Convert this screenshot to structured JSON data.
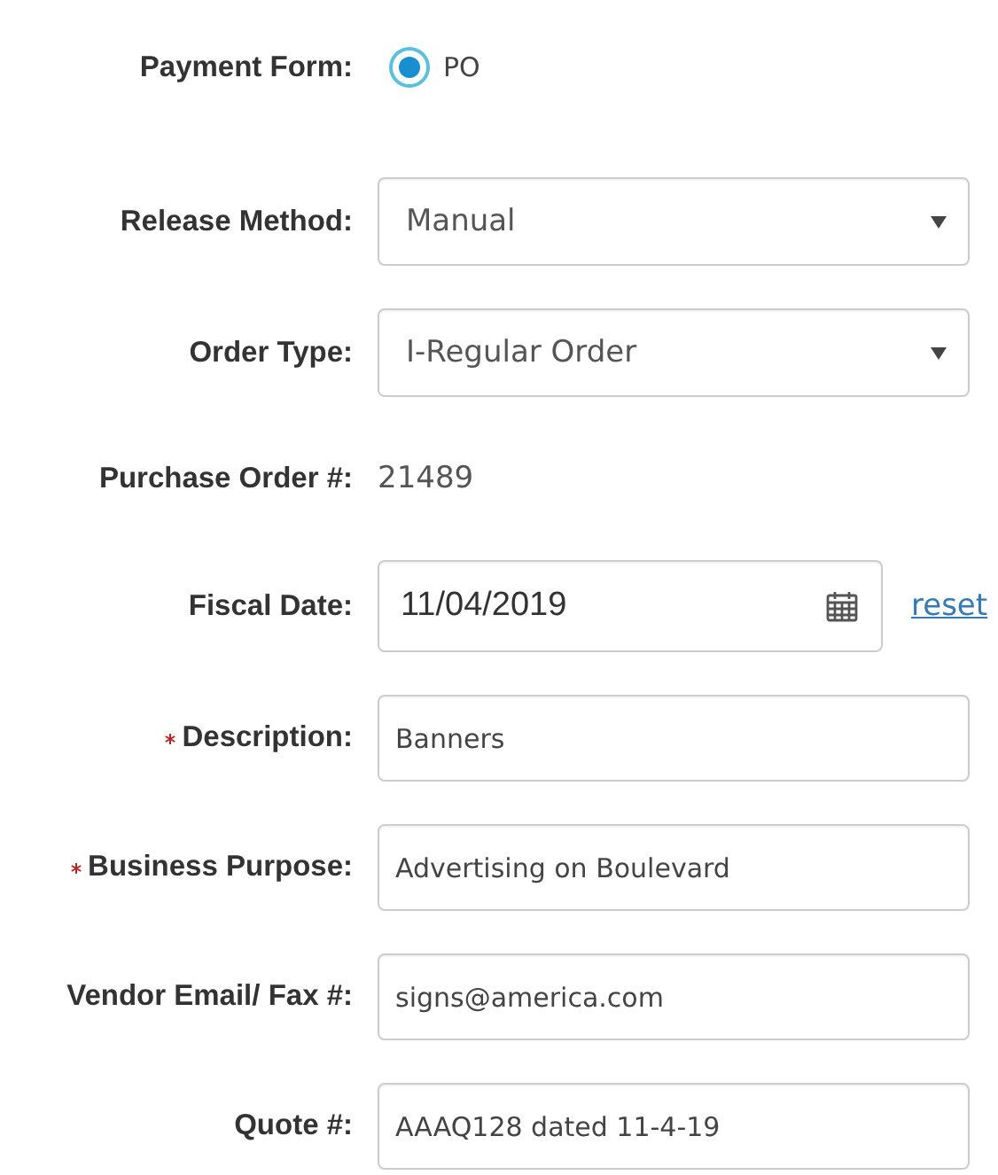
{
  "fields": [
    {
      "kind": "radio",
      "label": "Payment Form:",
      "required": false,
      "options": [
        {
          "label": "PO",
          "selected": true
        }
      ]
    },
    {
      "kind": "select",
      "label": "Release Method:",
      "required": false,
      "value": "Manual"
    },
    {
      "kind": "select",
      "label": "Order Type:",
      "required": false,
      "value": "I-Regular Order"
    },
    {
      "kind": "static",
      "label": "Purchase Order #:",
      "required": false,
      "value": "21489"
    },
    {
      "kind": "date",
      "label": "Fiscal Date:",
      "required": false,
      "value": "11/04/2019",
      "link": "reset"
    },
    {
      "kind": "text",
      "label": "Description:",
      "required": true,
      "value": "Banners"
    },
    {
      "kind": "text",
      "label": "Business Purpose:",
      "required": true,
      "value": "Advertising on Boulevard"
    },
    {
      "kind": "text",
      "label": "Vendor Email/ Fax #:",
      "required": false,
      "value": "signs@america.com"
    },
    {
      "kind": "text",
      "label": "Quote #:",
      "required": false,
      "value": "AAAQ128 dated 11-4-19"
    }
  ]
}
